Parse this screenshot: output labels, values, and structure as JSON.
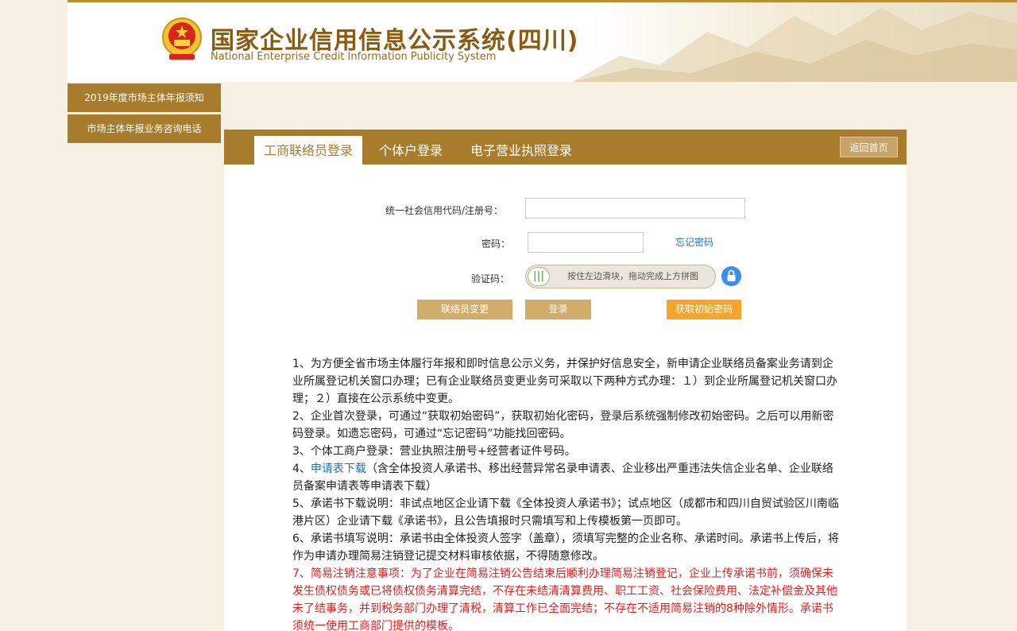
{
  "header": {
    "title_cn": "国家企业信用信息公示系统(四川)",
    "title_en": "National Enterprise Credit Information Publicity System"
  },
  "sidebar": {
    "items": [
      {
        "label": "2019年度市场主体年报须知"
      },
      {
        "label": "市场主体年报业务咨询电话"
      }
    ]
  },
  "tabs": [
    {
      "label": "工商联络员登录",
      "active": true
    },
    {
      "label": "个体户登录",
      "active": false
    },
    {
      "label": "电子营业执照登录",
      "active": false
    }
  ],
  "home_button": "返回首页",
  "form": {
    "code_label": "统一社会信用代码/注册号：",
    "code_value": "",
    "password_label": "密码：",
    "password_value": "",
    "forgot_link": "忘记密码",
    "captcha_label": "验证码：",
    "slider_text": "按住左边滑块，拖动完成上方拼图"
  },
  "buttons": {
    "change_contact": "联络员变更",
    "login": "登录",
    "get_password": "获取初始密码"
  },
  "notes": {
    "n1": "1、为方便全省市场主体履行年报和即时信息公示义务，并保护好信息安全，新申请企业联络员备案业务请到企业所属登记机关窗口办理；已有企业联络员变更业务可采取以下两种方式办理：１）到企业所属登记机关窗口办理；２）直接在公示系统中变更。",
    "n2": "2、企业首次登录，可通过“获取初始密码”，获取初始化密码，登录后系统强制修改初始密码。之后可以用新密码登录。如遗忘密码，可通过“忘记密码”功能找回密码。",
    "n3": "3、个体工商户登录：营业执照注册号+经营者证件号码。",
    "n4_prefix": "4、",
    "n4_link": "申请表下载",
    "n4_rest": "（含全体投资人承诺书、移出经营异常名录申请表、企业移出严重违法失信企业名单、企业联络员备案申请表等申请表下载）",
    "n5": "5、承诺书下载说明：非试点地区企业请下载《全体投资人承诺书》；试点地区（成都市和四川自贸试验区川南临港片区）企业请下载《承诺书》，且公告填报时只需填写和上传模板第一页即可。",
    "n6": "6、承诺书填写说明：承诺书由全体投资人签字（盖章），须填写完整的企业名称、承诺时间。承诺书上传后，将作为申请办理简易注销登记提交材料审核依据，不得随意修改。",
    "n7": "7、简易注销注意事项：为了企业在简易注销公告结束后顺利办理简易注销登记，企业上传承诺书前，须确保未发生债权债务或已将债权债务清算完结，不存在未结清清算费用、职工工资、社会保险费用、法定补偿金及其他未了结事务，并到税务部门办理了清税，清算工作已全面完结；不存在不适用简易注销的8种除外情形。承诺书须统一使用工商部门提供的模板。"
  },
  "colors": {
    "brand": "#a77c2c",
    "button": "#d2ac6b",
    "accent_button": "#f4a62a",
    "link": "#1f6fc5",
    "warning_text": "#e02020"
  }
}
